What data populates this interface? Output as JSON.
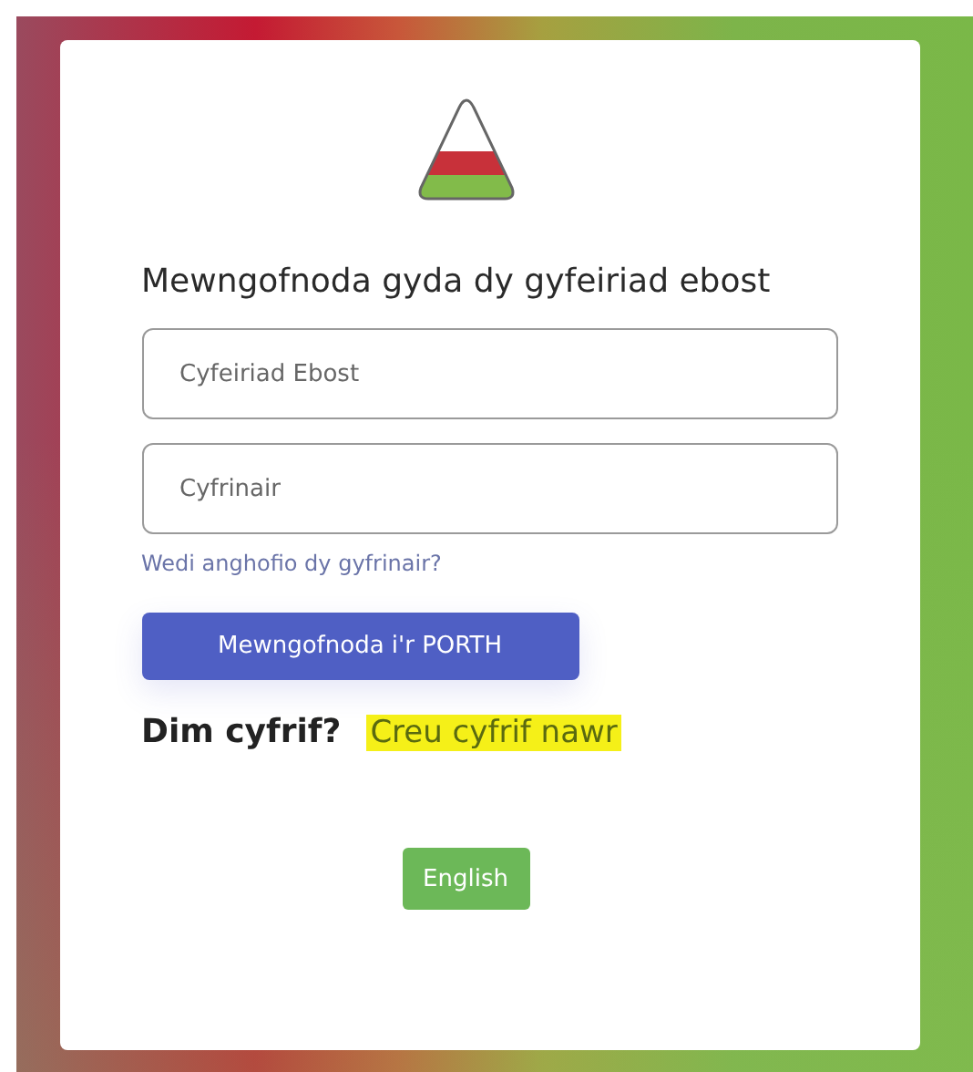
{
  "heading": "Mewngofnoda gyda dy gyfeiriad ebost",
  "fields": [
    {
      "placeholder": "Cyfeiriad Ebost"
    },
    {
      "placeholder": "Cyfrinair"
    }
  ],
  "forgot_link": "Wedi anghofio dy gyfrinair?",
  "login_button": "Mewngofnoda i'r PORTH",
  "signup": {
    "prompt": "Dim cyfrif?",
    "link": "Creu cyfrif nawr"
  },
  "language_button": "English"
}
